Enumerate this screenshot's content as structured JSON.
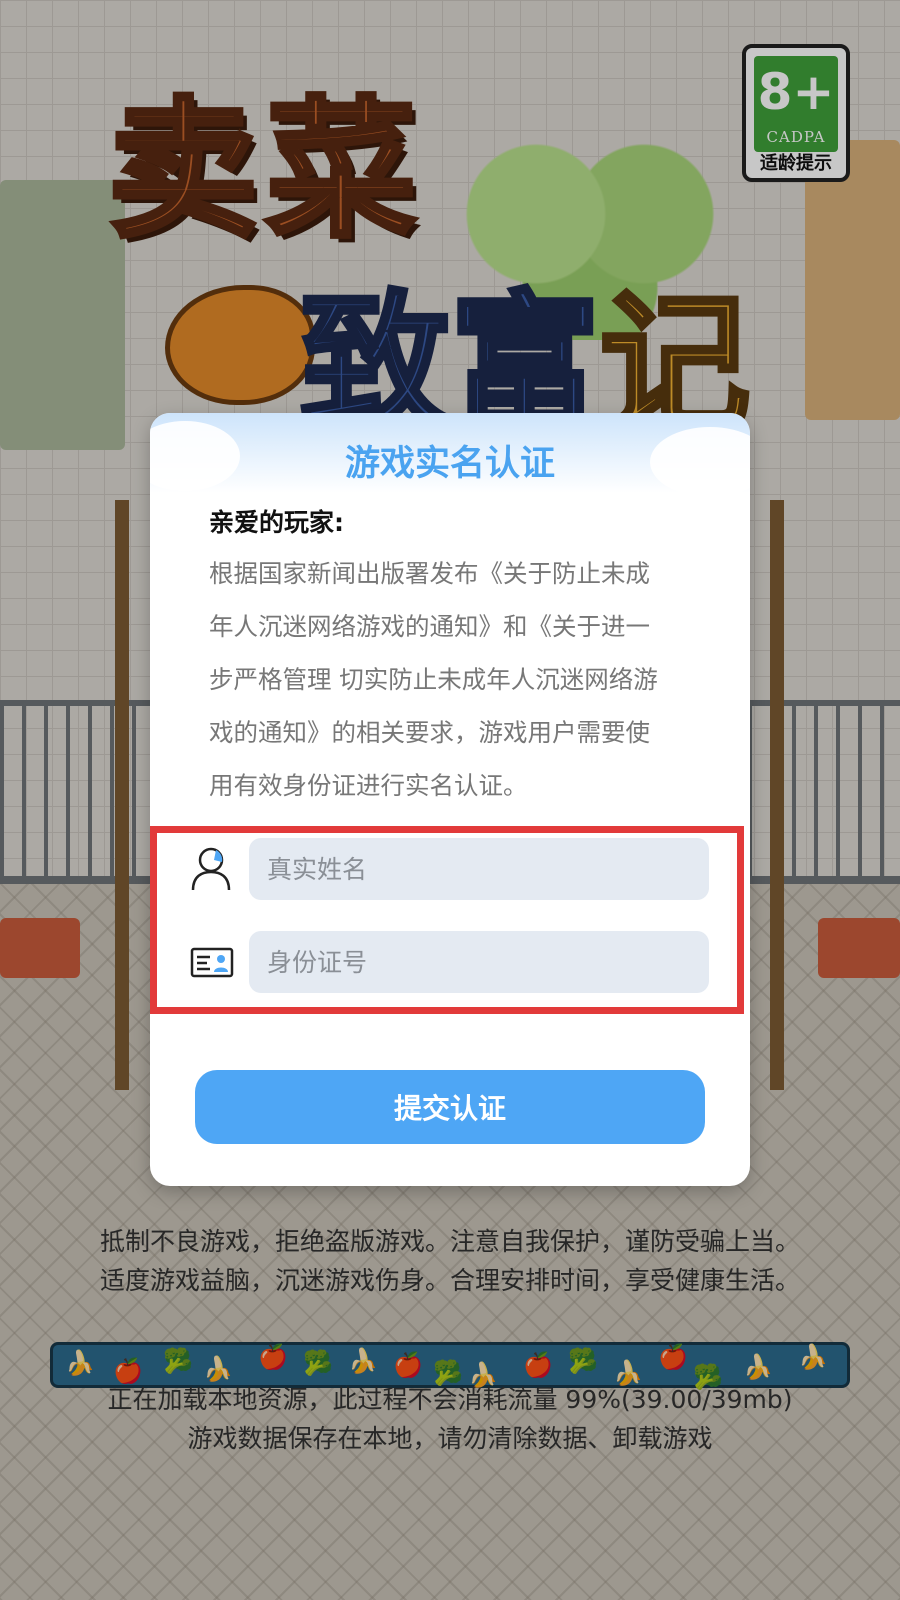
{
  "background": {
    "logo_line1": "卖菜",
    "logo_line2_a": "致",
    "logo_line2_b": "富",
    "logo_line2_c": "记",
    "age_rating": "8+",
    "age_org": "CADPA",
    "age_tip": "适龄提示",
    "notice_line1": "抵制不良游戏，拒绝盗版游戏。注意自我保护，谨防受骗上当。",
    "notice_line2": "适度游戏益脑，沉迷游戏伤身。合理安排时间，享受健康生活。",
    "loading_text": "正在加载本地资源，此过程不会消耗流量 99%(39.00/39mb)",
    "storage_text": "游戏数据保存在本地，请勿清除数据、卸载游戏",
    "loading_progress": 0.99
  },
  "dialog": {
    "title": "游戏实名认证",
    "greeting": "亲爱的玩家:",
    "body": "根据国家新闻出版署发布《关于防止未成\n年人沉迷网络游戏的通知》和《关于进一\n步严格管理 切实防止未成年人沉迷网络游\n戏的通知》的相关要求，游戏用户需要使\n用有效身份证进行实名认证。",
    "name_field": {
      "placeholder": "真实姓名",
      "value": "",
      "icon": "user-icon"
    },
    "id_field": {
      "placeholder": "身份证号",
      "value": "",
      "icon": "id-card-icon"
    },
    "submit_label": "提交认证"
  },
  "colors": {
    "accent": "#4ea6f5",
    "title": "#4aa3f0",
    "highlight": "#e23a3a",
    "input_bg": "#e4eaf2"
  }
}
